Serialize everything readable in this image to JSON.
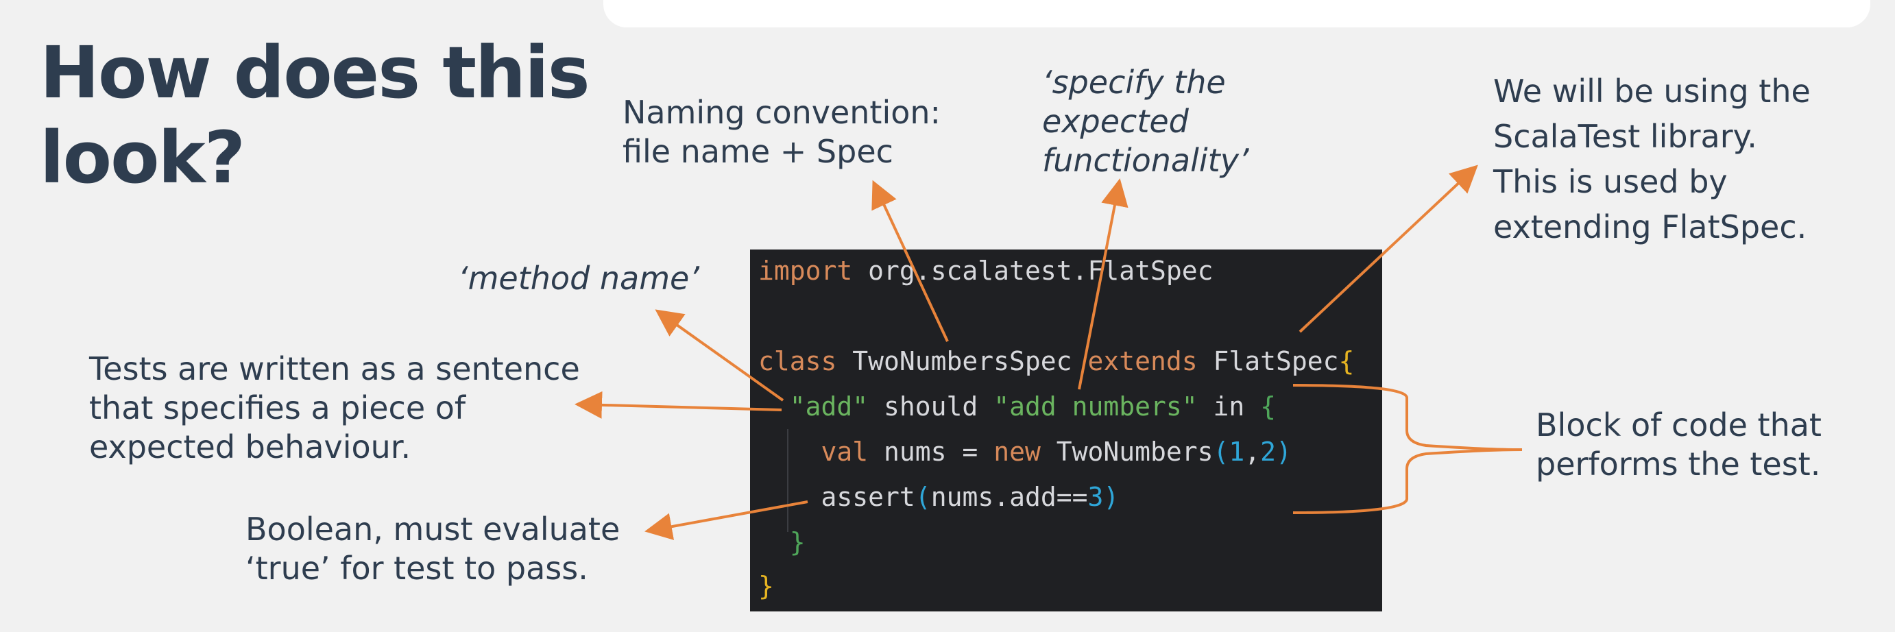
{
  "slide": {
    "title_line1": "How does this",
    "title_line2": "look?"
  },
  "notes": {
    "naming_line1": "Naming convention:",
    "naming_line2": "file name + Spec",
    "specify_line1": "‘specify the",
    "specify_line2": "expected",
    "specify_line3": "functionality’",
    "library_line1": "We will be using the",
    "library_line2": "ScalaTest library.",
    "library_line3": "This is used by",
    "library_line4": "extending FlatSpec.",
    "method_name": "‘method name’",
    "sentence_line1": "Tests are written as a sentence",
    "sentence_line2": "that specifies a piece of",
    "sentence_line3": "expected behaviour.",
    "block_line1": "Block of code that",
    "block_line2": "performs the test.",
    "boolean_line1": "Boolean, must evaluate",
    "boolean_line2": "‘true’ for test to pass."
  },
  "code": {
    "import_kw": "import",
    "import_path": " org.scalatest.FlatSpec",
    "class_kw": "class",
    "class_name": " TwoNumbersSpec ",
    "extends_kw": "extends",
    "parent": " FlatSpec",
    "open_brace": "{",
    "indent1": "  ",
    "subject": "\"add\"",
    "should": " should ",
    "behaviour": "\"add numbers\"",
    "in_kw": " in ",
    "inner_open": "{",
    "indent2": "    ",
    "val_kw": "val",
    "nums_assign": " nums = ",
    "new_kw": "new",
    "ctor": " TwoNumbers",
    "lparen": "(",
    "arg1": "1",
    "comma": ",",
    "arg2": "2",
    "rparen": ")",
    "assert_fn": "assert",
    "lparen2": "(",
    "assert_expr": "nums.add==",
    "assert_val": "3",
    "rparen2": ")",
    "inner_close": "}",
    "outer_close": "}"
  },
  "colors": {
    "background": "#f1f1f1",
    "text": "#2e3d4f",
    "arrow": "#e8833a",
    "code_bg": "#1f2023",
    "keyword": "#d88a5a",
    "string": "#6ab45f",
    "number": "#2fa6d8"
  }
}
